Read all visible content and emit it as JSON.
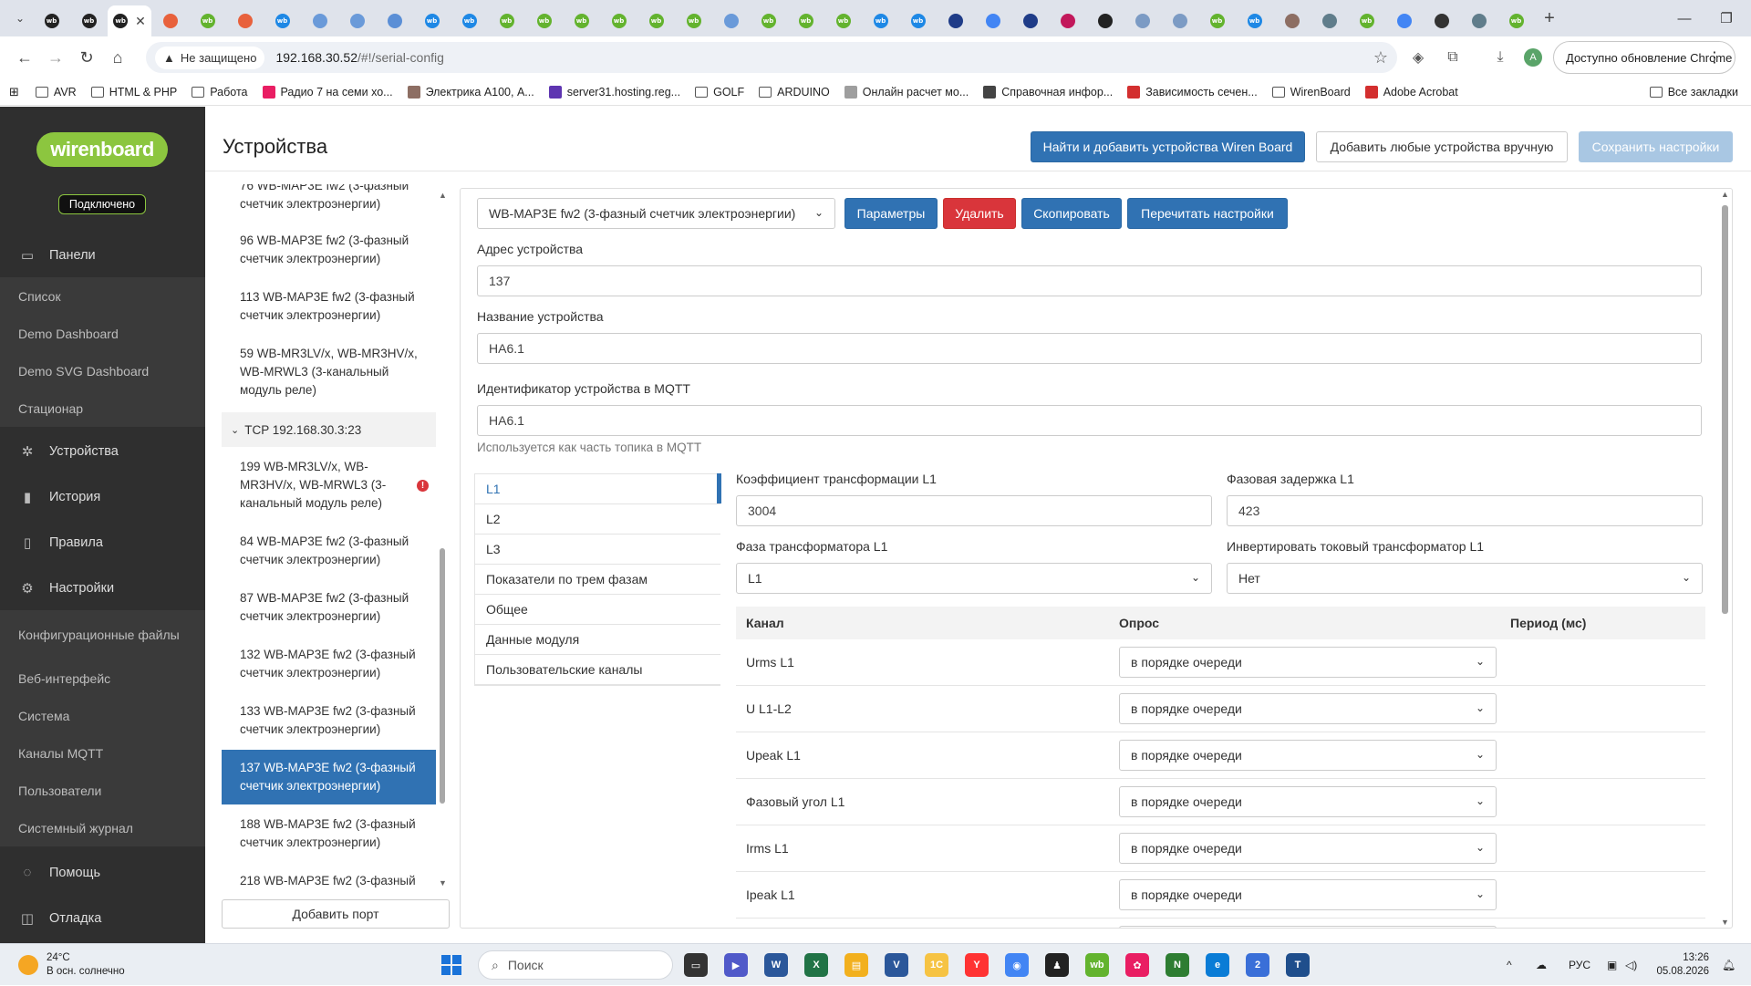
{
  "browser": {
    "tabs": [
      {
        "name": "wb",
        "color": "#222"
      },
      {
        "name": "wb",
        "color": "#222"
      },
      {
        "name": "wb-active",
        "color": "#222"
      },
      {
        "name": "chrome-red",
        "color": "#e8613c"
      },
      {
        "name": "wb-green",
        "color": "#63b32e"
      },
      {
        "name": "chrome-red",
        "color": "#e8613c"
      },
      {
        "name": "wb-blue",
        "color": "#1e88e5"
      },
      {
        "name": "gear",
        "color": "#6a9ad9"
      },
      {
        "name": "gear",
        "color": "#6a9ad9"
      },
      {
        "name": "msg",
        "color": "#5b8fd6"
      },
      {
        "name": "wb-blue",
        "color": "#1e88e5"
      },
      {
        "name": "wb-blue",
        "color": "#1e88e5"
      },
      {
        "name": "wb-green",
        "color": "#63b32e"
      },
      {
        "name": "wb-green",
        "color": "#63b32e"
      },
      {
        "name": "wb-green",
        "color": "#63b32e"
      },
      {
        "name": "wb-green",
        "color": "#63b32e"
      },
      {
        "name": "wb-green",
        "color": "#63b32e"
      },
      {
        "name": "wb-green",
        "color": "#63b32e"
      },
      {
        "name": "gear",
        "color": "#6a9ad9"
      },
      {
        "name": "wb-green",
        "color": "#63b32e"
      },
      {
        "name": "wb-green",
        "color": "#63b32e"
      },
      {
        "name": "wb-green",
        "color": "#63b32e"
      },
      {
        "name": "wb-blue",
        "color": "#1e88e5"
      },
      {
        "name": "wb-blue",
        "color": "#1e88e5"
      },
      {
        "name": "pen",
        "color": "#1f3c88"
      },
      {
        "name": "google",
        "color": "#4285f4"
      },
      {
        "name": "k",
        "color": "#1f3c88"
      },
      {
        "name": "diamond",
        "color": "#c2185b"
      },
      {
        "name": "k-red",
        "color": "#222"
      },
      {
        "name": "bar",
        "color": "#7c9bc4"
      },
      {
        "name": "bar",
        "color": "#7c9bc4"
      },
      {
        "name": "wb-green",
        "color": "#63b32e"
      },
      {
        "name": "wb-blue",
        "color": "#1e88e5"
      },
      {
        "name": "box",
        "color": "#8d6e63"
      },
      {
        "name": "globe",
        "color": "#607d8b"
      },
      {
        "name": "wb-green",
        "color": "#63b32e"
      },
      {
        "name": "google",
        "color": "#4285f4"
      },
      {
        "name": "g-dark",
        "color": "#333"
      },
      {
        "name": "globe",
        "color": "#607d8b"
      },
      {
        "name": "wb-green",
        "color": "#63b32e"
      }
    ],
    "tab_badge": "wb",
    "new_tab": "+",
    "security_label": "Не защищено",
    "url_host": "192.168.30.52",
    "url_path": "/#!/serial-config",
    "update_label": "Доступно обновление Chrome",
    "profile_initial": "A",
    "bookmarks": [
      "AVR",
      "HTML & PHP",
      "Работа",
      "Радио 7 на семи хо...",
      "Электрика А100, А...",
      "server31.hosting.reg...",
      "GOLF",
      "ARDUINO",
      "Онлайн расчет мо...",
      "Справочная инфор...",
      "Зависимость сечен...",
      "WirenBoard",
      "Adobe Acrobat"
    ],
    "all_bookmarks": "Все закладки"
  },
  "app": {
    "logo": "wirenboard",
    "status": "Подключено",
    "nav": {
      "panels": "Панели",
      "panel_items": [
        "Список",
        "Demo Dashboard",
        "Demo SVG Dashboard",
        "Стационар"
      ],
      "devices": "Устройства",
      "history": "История",
      "rules": "Правила",
      "settings": "Настройки",
      "settings_items": [
        "Конфигурационные файлы",
        "Веб-интерфейс",
        "Система",
        "Каналы MQTT",
        "Пользователи",
        "Системный журнал"
      ],
      "help": "Помощь",
      "debug": "Отладка"
    },
    "title": "Устройства",
    "btn_find": "Найти и добавить устройства Wiren Board",
    "btn_add_manual": "Добавить любые устройства вручную",
    "btn_save": "Сохранить настройки",
    "device_list": {
      "top_partial": "76 WB-MAP3E fw2 (3-фазный счетчик электроэнергии)",
      "items_a": [
        "96 WB-MAP3E fw2 (3-фазный счетчик электроэнергии)",
        "113 WB-MAP3E fw2 (3-фазный счетчик электроэнергии)",
        "59 WB-MR3LV/x, WB-MR3HV/x, WB-MRWL3 (3-канальный модуль реле)"
      ],
      "group": "TCP 192.168.30.3:23",
      "items_b": [
        "199 WB-MR3LV/x, WB-MR3HV/x, WB-MRWL3 (3-канальный модуль реле)",
        "84 WB-MAP3E fw2 (3-фазный счетчик электроэнергии)",
        "87 WB-MAP3E fw2 (3-фазный счетчик электроэнергии)",
        "132 WB-MAP3E fw2 (3-фазный счетчик электроэнергии)",
        "133 WB-MAP3E fw2 (3-фазный счетчик электроэнергии)",
        "137 WB-MAP3E fw2 (3-фазный счетчик электроэнергии)",
        "188 WB-MAP3E fw2 (3-фазный счетчик электроэнергии)",
        "218 WB-MAP3E fw2 (3-фазный"
      ],
      "error_mark": "!",
      "add_port": "Добавить порт"
    },
    "editor": {
      "device_type": "WB-MAP3E fw2 (3-фазный счетчик электроэнергии)",
      "btn_params": "Параметры",
      "btn_delete": "Удалить",
      "btn_copy": "Скопировать",
      "btn_reread": "Перечитать настройки",
      "addr_label": "Адрес устройства",
      "addr_value": "137",
      "name_label": "Название устройства",
      "name_value": "НА6.1",
      "mqtt_label": "Идентификатор устройства в MQTT",
      "mqtt_value": "НА6.1",
      "mqtt_help": "Используется как часть топика в MQTT",
      "tabs": [
        "L1",
        "L2",
        "L3",
        "Показатели по трем фазам",
        "Общее",
        "Данные модуля",
        "Пользовательские каналы"
      ],
      "ct_label": "Коэффициент трансформации L1",
      "ct_value": "3004",
      "delay_label": "Фазовая задержка L1",
      "delay_value": "423",
      "phase_label": "Фаза трансформатора L1",
      "phase_value": "L1",
      "invert_label": "Инвертировать токовый трансформатор L1",
      "invert_value": "Нет",
      "col_channel": "Канал",
      "col_poll": "Опрос",
      "col_period": "Период (мс)",
      "rows": [
        {
          "name": "Urms L1",
          "poll": "в порядке очереди"
        },
        {
          "name": "U L1-L2",
          "poll": "в порядке очереди"
        },
        {
          "name": "Upeak L1",
          "poll": "в порядке очереди"
        },
        {
          "name": "Фазовый угол L1",
          "poll": "в порядке очереди"
        },
        {
          "name": "Irms L1",
          "poll": "в порядке очереди"
        },
        {
          "name": "Ipeak L1",
          "poll": "в порядке очереди"
        }
      ]
    }
  },
  "taskbar": {
    "temp": "24°C",
    "weather": "В осн. солнечно",
    "search": "Поиск",
    "apps": [
      {
        "label": "▭",
        "color": "#333"
      },
      {
        "label": "▶",
        "color": "#5059c9"
      },
      {
        "label": "W",
        "color": "#2b579a"
      },
      {
        "label": "X",
        "color": "#217346"
      },
      {
        "label": "▤",
        "color": "#f2b01e"
      },
      {
        "label": "V",
        "color": "#2b579a"
      },
      {
        "label": "1С",
        "color": "#f6c343"
      },
      {
        "label": "Y",
        "color": "#f33"
      },
      {
        "label": "◉",
        "color": "#4285f4"
      },
      {
        "label": "♟",
        "color": "#222"
      },
      {
        "label": "wb",
        "color": "#63b32e"
      },
      {
        "label": "✿",
        "color": "#e91e63"
      },
      {
        "label": "N",
        "color": "#2e7d32"
      },
      {
        "label": "e",
        "color": "#0a7cd6"
      },
      {
        "label": "2",
        "color": "#3a6fd8"
      },
      {
        "label": "T",
        "color": "#1f4e8c"
      }
    ],
    "lang": "РУС",
    "time": "13:26",
    "date": "05.08.2026"
  }
}
